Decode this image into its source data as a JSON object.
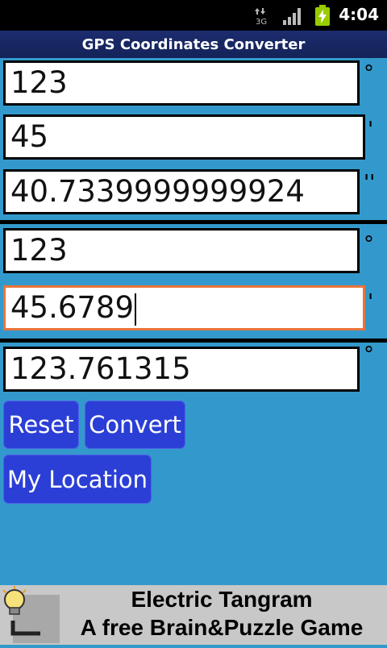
{
  "status_bar": {
    "time": "4:04",
    "network_label": "3G"
  },
  "app": {
    "title": "GPS Coordinates Converter"
  },
  "dms": {
    "degrees": "123",
    "minutes": "45",
    "seconds": "40.7339999999924",
    "degree_symbol": "°",
    "minute_symbol": "'",
    "second_symbol": "''"
  },
  "dm": {
    "degrees": "123",
    "minutes": "45.6789",
    "degree_symbol": "°",
    "minute_symbol": "'"
  },
  "dd": {
    "degrees": "123.761315",
    "degree_symbol": "°"
  },
  "buttons": {
    "reset": "Reset",
    "convert": "Convert",
    "my_location": "My Location"
  },
  "ad": {
    "line1": "Electric Tangram",
    "line2": "A free Brain&Puzzle Game",
    "icon": "lightbulb-icon"
  },
  "colors": {
    "background": "#3399cc",
    "button": "#2b3fd6",
    "focus_border": "#e8743a",
    "title_bar": "#1c2c6e"
  }
}
